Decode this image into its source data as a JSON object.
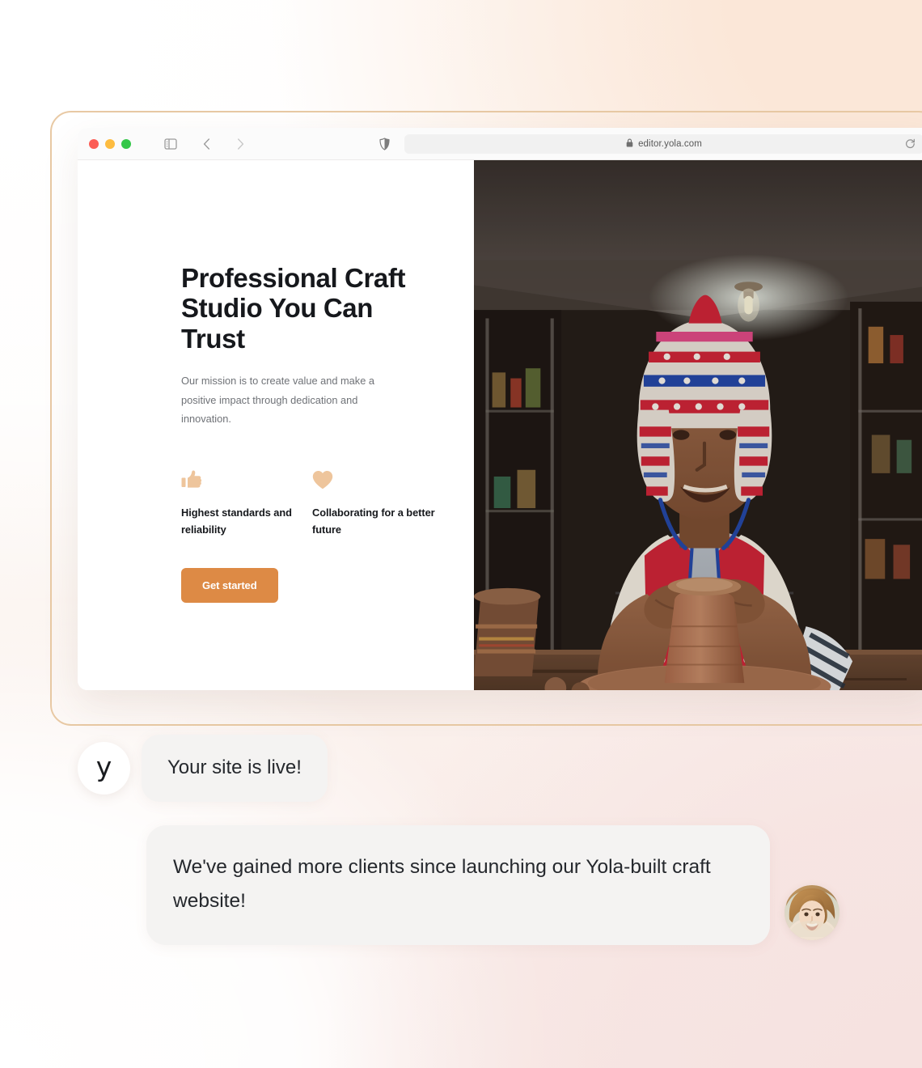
{
  "browser": {
    "traffic_lights": [
      "close",
      "minimize",
      "zoom"
    ],
    "sidebar_toggle_icon": "sidebar-toggle-icon",
    "back_icon": "chevron-left-icon",
    "forward_icon": "chevron-right-icon",
    "shield_icon": "privacy-shield-icon",
    "lock_icon": "lock-icon",
    "url": "editor.yola.com",
    "reload_icon": "reload-icon"
  },
  "hero": {
    "title": "Professional Craft Studio You Can Trust",
    "subtitle": "Our mission is to create value and make a positive impact through dedication and innovation.",
    "features": [
      {
        "icon": "thumbs-up-icon",
        "label": "Highest standards and reliability"
      },
      {
        "icon": "heart-icon",
        "label": "Collaborating for a better future"
      }
    ],
    "cta_label": "Get started",
    "photo_alt": "Artisan in traditional Andean chullo hat shaping clay on a pottery wheel"
  },
  "chat": {
    "brand_logo_letter": "y",
    "messages": [
      {
        "text": "Your site is live!"
      },
      {
        "text": "We've gained more clients since launching our Yola-built craft website!"
      }
    ],
    "avatar_alt": "Smiling woman with long wavy light-brown hair"
  },
  "colors": {
    "cta_background": "#dd8a45",
    "feature_icon": "#eec59c",
    "frame_border": "#e8c9a4",
    "bubble_background": "#f4f3f2",
    "heading_text": "#16181c"
  }
}
